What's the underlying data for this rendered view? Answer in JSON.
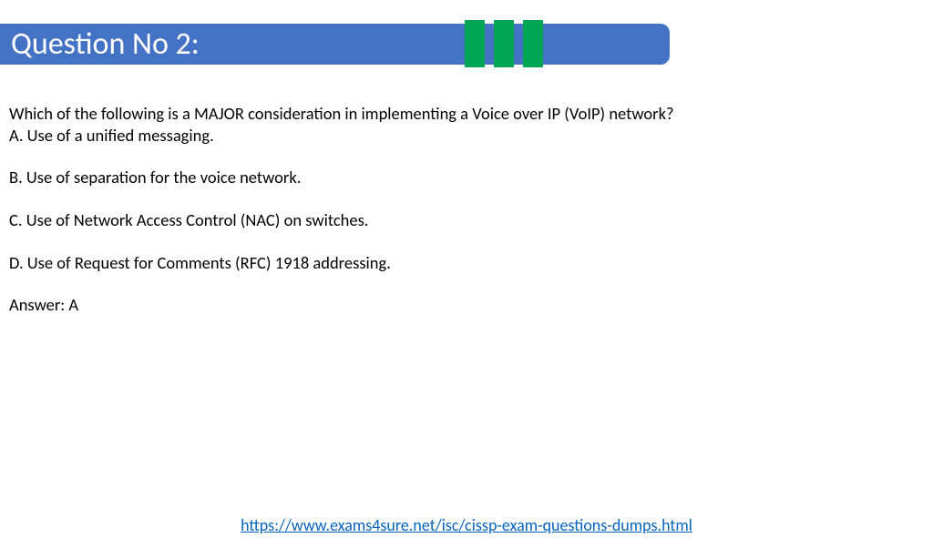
{
  "header": {
    "title": "Question No 2:"
  },
  "question": {
    "prompt": "Which of the following is a MAJOR consideration in implementing a Voice over IP (VoIP) network?",
    "options": {
      "a": "A. Use of a unified messaging.",
      "b": "B. Use of separation for the voice network.",
      "c": "C. Use of Network Access Control (NAC) on switches.",
      "d": "D. Use of Request for Comments (RFC) 1918 addressing."
    },
    "answer": "Answer: A"
  },
  "footer": {
    "url": "https://www.exams4sure.net/isc/cissp-exam-questions-dumps.html"
  }
}
